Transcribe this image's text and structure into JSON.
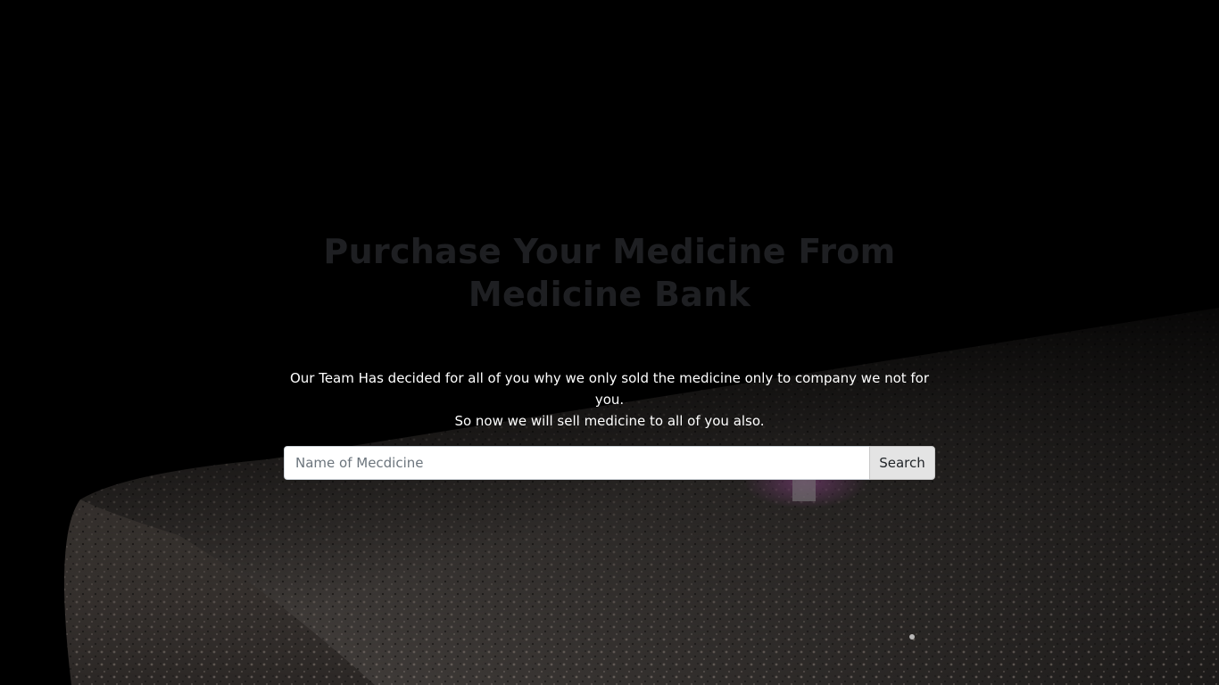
{
  "hero": {
    "title": "Purchase Your Medicine From Medicine Bank",
    "lead_line1": "Our Team Has decided for all of you why we only sold the medicine only to company we not for you.",
    "lead_line2": "So now we will sell medicine to all of you also."
  },
  "search": {
    "placeholder": "Name of Mecdicine",
    "value": "",
    "button_label": "Search"
  },
  "colors": {
    "background": "#000000",
    "title": "#1e1f22",
    "lead_text": "#ffffff",
    "button_bg": "#e4e4e4"
  },
  "background_image": "granite-slab-photo"
}
